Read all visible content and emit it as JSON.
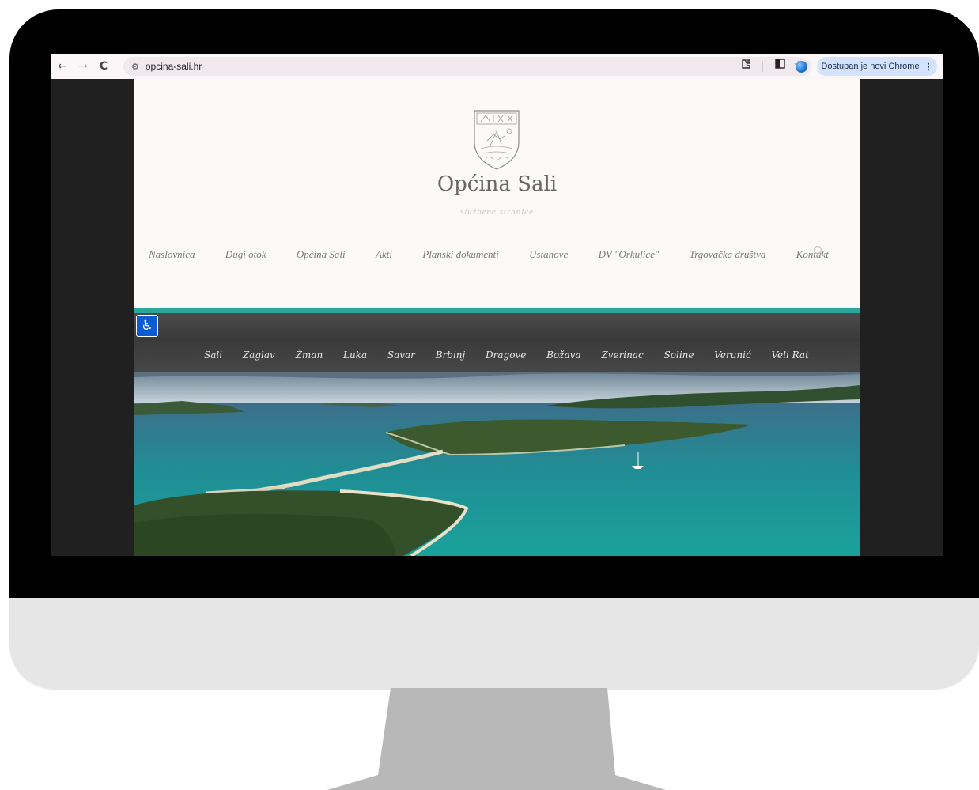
{
  "browser": {
    "url": "opcina-sali.hr",
    "update_label": "Dostupan je novi Chrome",
    "back_icon": "←",
    "forward_icon": "→",
    "reload_icon": "C",
    "site_info_icon": "⚙",
    "star_icon": "☆",
    "menu_icon": "⋮"
  },
  "site": {
    "title": "Općina Sali",
    "subtitle": "službene stranice"
  },
  "nav": {
    "items": [
      "Naslovnica",
      "Dugi otok",
      "Općina Sali",
      "Akti",
      "Planski dokumenti",
      "Ustanove",
      "DV \"Orkulice\"",
      "Trgovačka društva",
      "Kontakt"
    ]
  },
  "villages": {
    "items": [
      "Sali",
      "Zaglav",
      "Žman",
      "Luka",
      "Savar",
      "Brbinj",
      "Dragove",
      "Božava",
      "Zverinac",
      "Soline",
      "Verunić",
      "Veli Rat"
    ]
  },
  "colors": {
    "accent": "#2aa69a",
    "band": "#3f3f3f",
    "accessibility": "#0b5bd3",
    "update_pill": "#d3e3fd"
  }
}
